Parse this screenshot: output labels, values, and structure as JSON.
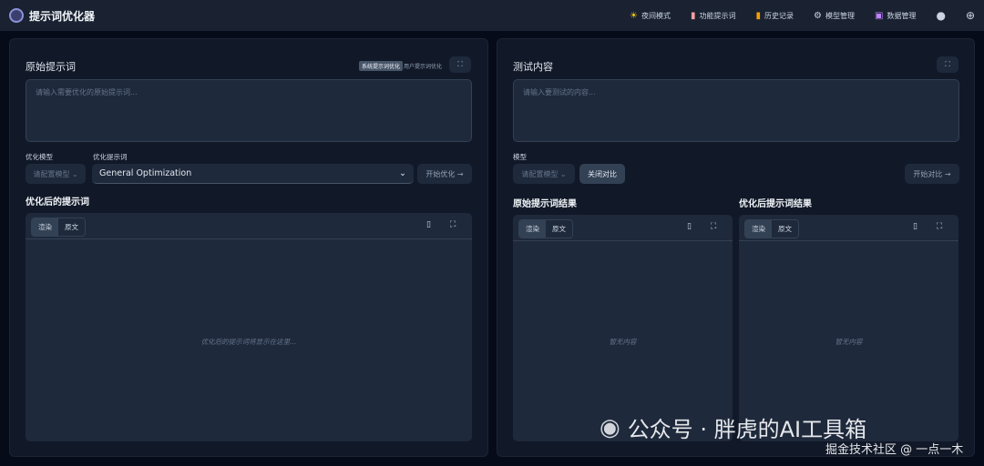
{
  "header": {
    "title": "提示词优化器",
    "nav": [
      {
        "icon": "sun-icon",
        "label": "夜间模式"
      },
      {
        "icon": "document-icon",
        "label": "功能提示词"
      },
      {
        "icon": "history-icon",
        "label": "历史记录"
      },
      {
        "icon": "gear-icon",
        "label": "模型管理"
      },
      {
        "icon": "save-icon",
        "label": "数据管理"
      }
    ]
  },
  "left": {
    "title": "原始提示词",
    "mode_system": "系统提示词优化",
    "mode_user": "用户提示词优化",
    "input_placeholder": "请输入需要优化的原始提示词...",
    "model_label": "优化模型",
    "model_value": "请配置模型",
    "template_label": "优化提示词",
    "template_value": "General Optimization",
    "optimize_button": "开始优化 →",
    "result_title": "优化后的提示词",
    "tab_render": "渲染",
    "tab_raw": "原文",
    "result_placeholder": "优化后的提示词将显示在这里..."
  },
  "right": {
    "title": "测试内容",
    "input_placeholder": "请输入要测试的内容...",
    "model_label": "模型",
    "model_value": "请配置模型",
    "close_compare": "关闭对比",
    "compare_button": "开始对比 →",
    "original_title": "原始提示词结果",
    "optimized_title": "优化后提示词结果",
    "tab_render": "渲染",
    "tab_raw": "原文",
    "empty": "暂无内容"
  },
  "watermark": {
    "line1": "公众号 · 胖虎的AI工具箱",
    "line2": "掘金技术社区 @ 一点一木"
  }
}
